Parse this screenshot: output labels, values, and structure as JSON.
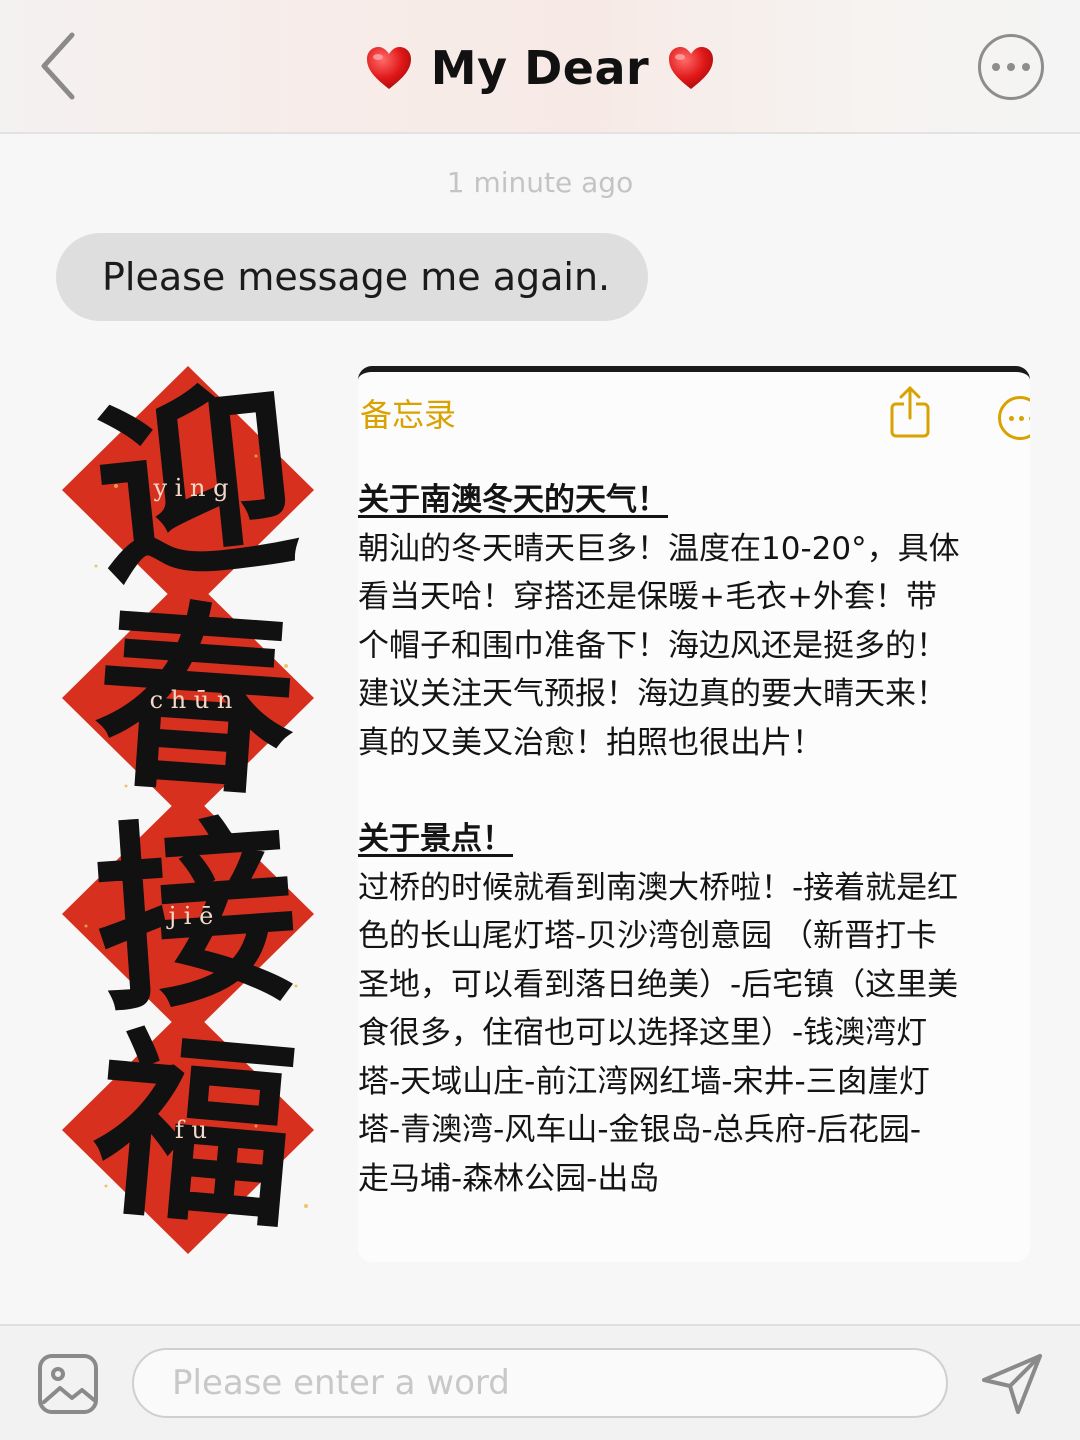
{
  "header": {
    "title": "My Dear",
    "left_heart_icon": "red-heart-icon",
    "right_heart_icon": "red-heart-icon",
    "back_icon": "chevron-left-icon",
    "more_icon": "more-circle-icon"
  },
  "chat": {
    "timestamp": "1 minute ago",
    "message": "Please message me again."
  },
  "couplet": {
    "characters": [
      "迎",
      "春",
      "接",
      "福"
    ],
    "pinyin": [
      "y i n g",
      "c h ū n",
      "j i ē",
      "f u"
    ]
  },
  "memo": {
    "back_label": "备忘录",
    "share_icon": "share-icon",
    "more_icon": "more-circle-icon",
    "accent_color": "#d9a200",
    "section1_heading": "关于南澳冬天的天气！",
    "section1_lines": [
      "朝汕的冬天晴天巨多！温度在10-20°，具体",
      "看当天哈！穿搭还是保暖+毛衣+外套！带",
      "个帽子和围巾准备下！海边风还是挺多的！",
      "建议关注天气预报！海边真的要大晴天来！",
      "真的又美又治愈！拍照也很出片！"
    ],
    "section2_heading": "关于景点！",
    "section2_lines": [
      "过桥的时候就看到南澳大桥啦！-接着就是红",
      "色的长山尾灯塔-贝沙湾创意园 （新晋打卡",
      "圣地，可以看到落日绝美）-后宅镇（这里美",
      "食很多，住宿也可以选择这里）-钱澳湾灯",
      "塔-天域山庄-前江湾网红墙-宋井-三囱崖灯",
      "塔-青澳湾-风车山-金银岛-总兵府-后花园-",
      "走马埔-森林公园-出岛"
    ]
  },
  "composer": {
    "placeholder": "Please enter a word",
    "image_icon": "image-icon",
    "send_icon": "send-icon"
  },
  "colors": {
    "couplet_red": "#d8301f",
    "bubble_gray": "#dedede"
  }
}
